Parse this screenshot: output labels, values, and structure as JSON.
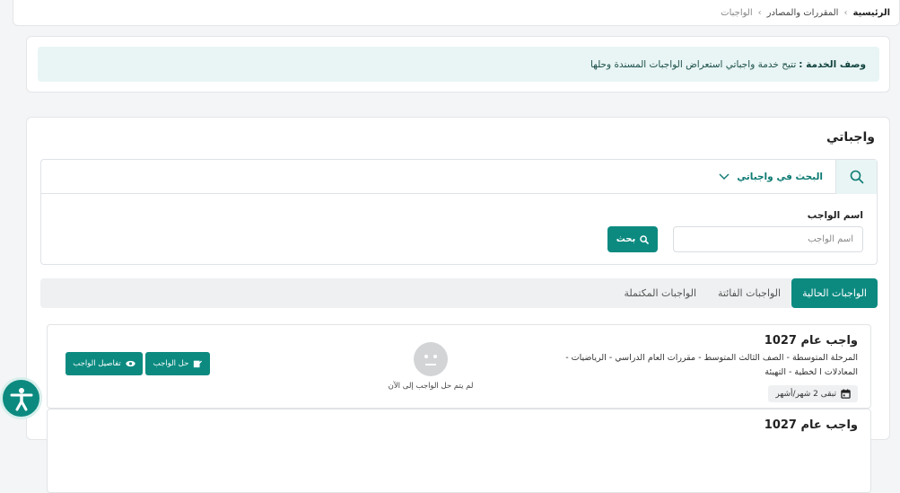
{
  "breadcrumb": {
    "items": [
      "الرئيسية",
      "المقررات والمصادر",
      "الواجبات"
    ]
  },
  "service": {
    "label": "وصف الخدمة :",
    "text": "تتيح خدمة واجباتي استعراض الواجبات المسندة وحلها"
  },
  "main": {
    "title": "واجباتي",
    "search": {
      "toggle_label": "البحث في واجباتي",
      "field_label": "اسم الواجب",
      "placeholder": "اسم الواجب",
      "button_label": "بحث"
    },
    "tabs": [
      {
        "label": "الواجبات الحالية",
        "active": true
      },
      {
        "label": "الواجبات الفائتة",
        "active": false
      },
      {
        "label": "الواجبات المكتملة",
        "active": false
      }
    ],
    "assignments": [
      {
        "title": "واجب عام 1027",
        "path": "المرحلة المتوسطة - الصف الثالث المتوسط - مقررات العام الدراسي - الرياضيات - المعادلات ا لخطية - التهيئة",
        "remaining": "تبقى 2 شهر/أشهر",
        "status": "لم يتم حل الواجب إلى الآن",
        "solve_label": "حل الواجب",
        "details_label": "تفاصيل الواجب"
      },
      {
        "title": "واجب عام 1027"
      }
    ]
  },
  "colors": {
    "primary": "#0c8a80",
    "light_accent": "#e8f5f4"
  }
}
